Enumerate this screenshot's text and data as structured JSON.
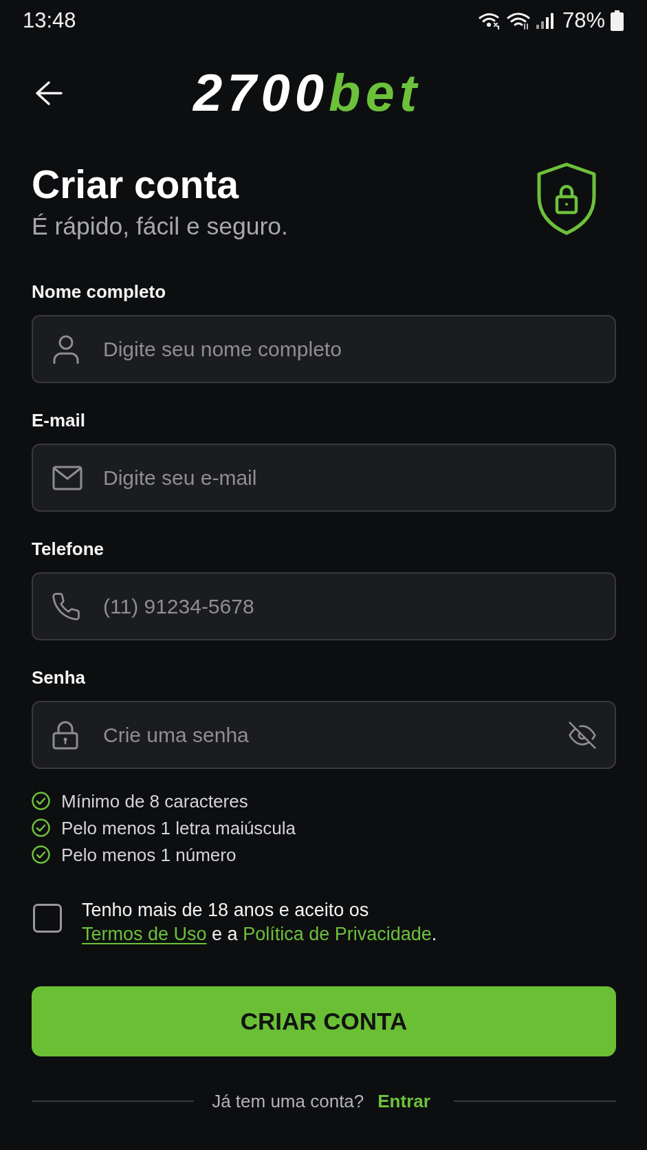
{
  "status_bar": {
    "time": "13:48",
    "battery": "78%"
  },
  "header": {
    "logo": {
      "main": "2700",
      "accent": "bet"
    }
  },
  "title": "Criar conta",
  "subtitle": "É rápido, fácil e seguro.",
  "fields": [
    {
      "kind": "name",
      "label": "Nome completo",
      "placeholder": "Digite seu nome completo"
    },
    {
      "kind": "email",
      "label": "E-mail",
      "placeholder": "Digite seu e-mail"
    },
    {
      "kind": "phone",
      "label": "Telefone",
      "placeholder": "(11) 91234-5678"
    },
    {
      "kind": "password",
      "label": "Senha",
      "placeholder": "Crie uma senha"
    }
  ],
  "requirements": [
    {
      "text": "Mínimo de 8 caracteres",
      "met": true
    },
    {
      "text": "Pelo menos 1 letra maiúscula",
      "met": true
    },
    {
      "text": "Pelo menos 1 número",
      "met": true
    }
  ],
  "consent": {
    "checked": false,
    "text": "Tenho mais de 18 anos e aceito os",
    "terms_link": "Termos de Uso",
    "joiner": "e a",
    "privacy_link": "Política de Privacidade",
    "end": "."
  },
  "submit_button": "CRIAR CONTA",
  "footer": {
    "text": "Já tem uma conta?",
    "link": "Entrar"
  }
}
